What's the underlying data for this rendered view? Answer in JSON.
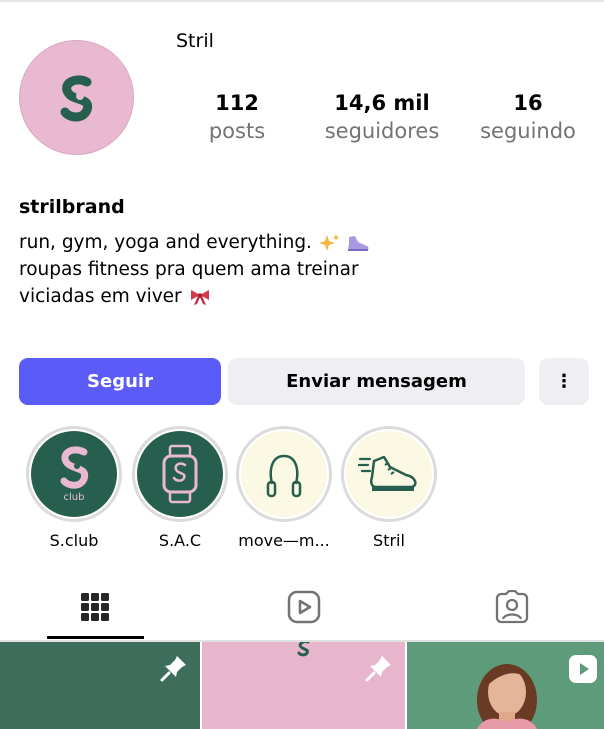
{
  "profile": {
    "name": "Stril",
    "username": "strilbrand",
    "stats": [
      {
        "value": "112",
        "label": "posts"
      },
      {
        "value": "14,6 mil",
        "label": "seguidores"
      },
      {
        "value": "16",
        "label": "seguindo"
      }
    ],
    "bio": [
      {
        "text": "run, gym, yoga and everything.",
        "emoji": [
          "sparkles",
          "sneaker"
        ]
      },
      {
        "text": "roupas fitness pra quem ama treinar",
        "emoji": []
      },
      {
        "text": "viciadas em viver",
        "emoji": [
          "ribbon"
        ]
      }
    ]
  },
  "actions": {
    "follow": "Seguir",
    "message": "Enviar mensagem",
    "more": "⋮"
  },
  "highlights": [
    {
      "label": "S.club",
      "icon": "stril-club-logo",
      "background": "#275f4f"
    },
    {
      "label": "S.A.C",
      "icon": "smartwatch-icon",
      "background": "#275f4f"
    },
    {
      "label": "move—m...",
      "icon": "jump-rope-icon",
      "background": "#fbf9e3"
    },
    {
      "label": "Stril",
      "icon": "running-shoe-icon",
      "background": "#fbf9e3"
    }
  ],
  "tabs": [
    {
      "name": "posts-grid",
      "icon": "grid-icon",
      "active": true
    },
    {
      "name": "reels",
      "icon": "reels-icon",
      "active": false
    },
    {
      "name": "tagged",
      "icon": "tagged-icon",
      "active": false
    }
  ],
  "posts": [
    {
      "badge": "pin-icon"
    },
    {
      "badge": "pin-icon"
    },
    {
      "badge": "reel-icon"
    }
  ],
  "colors": {
    "follow_button": "#5b5bf7",
    "secondary_button": "#efeff3",
    "avatar_bg": "#e8b9d1",
    "brand_green": "#275f4f"
  }
}
